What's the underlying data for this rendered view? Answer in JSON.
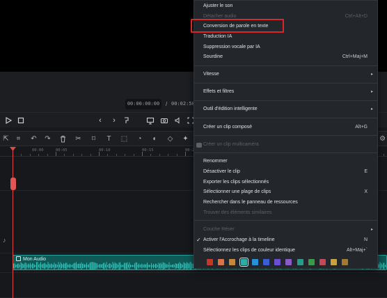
{
  "preview": {
    "current_time": "00:00:00:00",
    "separator": "/",
    "total_time": "00:02:50:"
  },
  "player": {
    "play_icon": "play-icon",
    "stop_icon": "stop-icon"
  },
  "ruler": {
    "labels": [
      "00:00",
      "00:05",
      "00:10",
      "00:15",
      "00:20"
    ]
  },
  "audio_clip": {
    "label": "Mon Audio"
  },
  "menu": {
    "items": [
      {
        "label": "Ajuster le son",
        "shortcut": "",
        "disabled": false
      },
      {
        "label": "Détacher audio",
        "shortcut": "Ctrl+Alt+D",
        "disabled": true
      },
      {
        "label": "Conversion de parole en texte",
        "shortcut": "",
        "disabled": false,
        "highlighted": true
      },
      {
        "label": "Traduction IA",
        "shortcut": "",
        "disabled": false
      },
      {
        "label": "Suppression vocale par IA",
        "shortcut": "",
        "disabled": false
      },
      {
        "label": "Sourdine",
        "shortcut": "Ctrl+Maj+M",
        "disabled": false
      },
      {
        "label": "Vitesse",
        "shortcut": "",
        "submenu": true
      },
      {
        "label": "Effets et filtres",
        "shortcut": "",
        "submenu": true
      },
      {
        "label": "Outil d'édition intelligente",
        "shortcut": "",
        "submenu": true
      },
      {
        "label": "Créer un clip composé",
        "shortcut": "Alt+G",
        "disabled": false
      },
      {
        "label": "Créer un clip multicaméra",
        "shortcut": "",
        "disabled": true
      },
      {
        "label": "Renommer",
        "shortcut": "",
        "disabled": false
      },
      {
        "label": "Désactiver le clip",
        "shortcut": "E",
        "disabled": false
      },
      {
        "label": "Exporter les clips sélectionnés",
        "shortcut": "",
        "disabled": false
      },
      {
        "label": "Sélectionner une plage de clips",
        "shortcut": "X",
        "disabled": false
      },
      {
        "label": "Rechercher dans le panneau de ressources",
        "shortcut": "",
        "disabled": false
      },
      {
        "label": "Trouver des éléments similaires",
        "shortcut": "",
        "disabled": true
      },
      {
        "label": "Couche Réser",
        "shortcut": "",
        "disabled": true,
        "submenu": true
      },
      {
        "label": "Activer l'Accrochage à la timeline",
        "shortcut": "N",
        "checked": true
      },
      {
        "label": "Sélectionnez les clips de couleur identique",
        "shortcut": "Alt+Maj+`",
        "disabled": false
      }
    ],
    "swatches": [
      "#c0392b",
      "#d9734a",
      "#c8883a",
      "#2bb0a8",
      "#2a8fd6",
      "#3b5fd0",
      "#6a4fd0",
      "#8a5ac8",
      "#2b9a8a",
      "#3a9a4a",
      "#c04a5a",
      "#c8a23a",
      "#a07a30"
    ],
    "selected_swatch": 3
  },
  "colors": {
    "accent_red": "#d9262b",
    "clip_teal": "#0f5a57",
    "playhead": "#e04848"
  }
}
